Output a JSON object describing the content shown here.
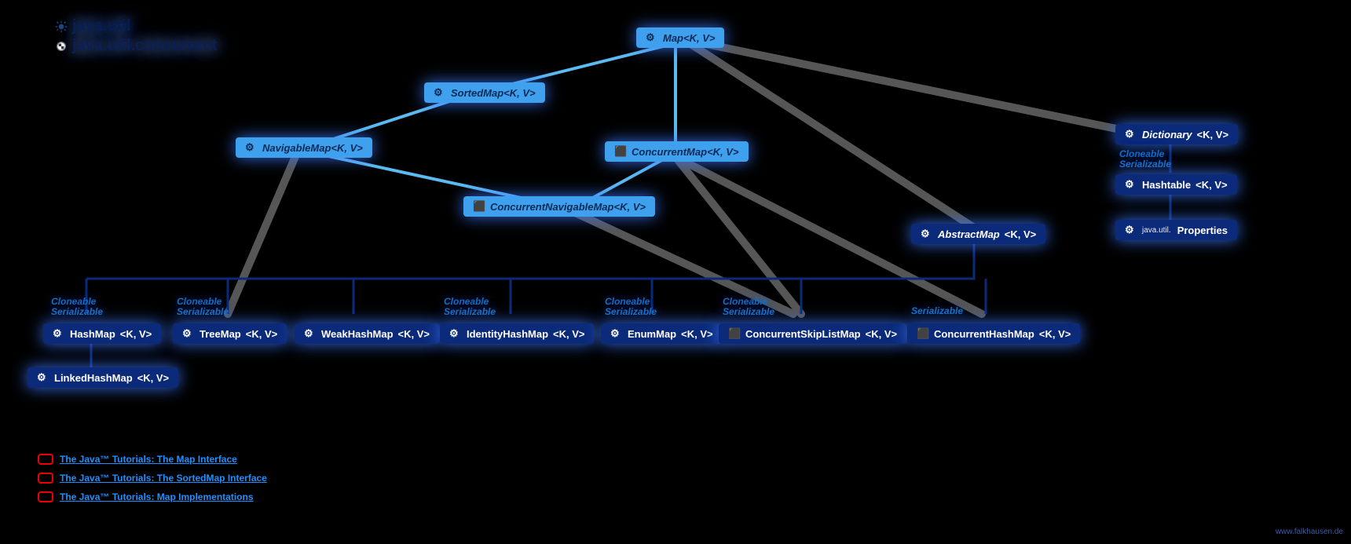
{
  "legend": {
    "pkg1": "java.util",
    "pkg2": "java.util.concurrent"
  },
  "nodes": {
    "map": {
      "label": "Map",
      "gen": "<K, V>"
    },
    "sortedmap": {
      "label": "SortedMap",
      "gen": "<K, V>"
    },
    "navmap": {
      "label": "NavigableMap",
      "gen": "<K, V>"
    },
    "concmap": {
      "label": "ConcurrentMap",
      "gen": "<K, V>"
    },
    "concnavmap": {
      "label": "ConcurrentNavigableMap",
      "gen": "<K, V>"
    },
    "absmap": {
      "label": "AbstractMap",
      "gen": "<K, V>"
    },
    "dict": {
      "label": "Dictionary",
      "gen": "<K, V>"
    },
    "hashtable": {
      "label": "Hashtable",
      "gen": "<K, V>"
    },
    "propspkg": "java.util.",
    "props": "Properties",
    "hashmap": {
      "label": "HashMap",
      "gen": "<K, V>"
    },
    "linkedhm": {
      "label": "LinkedHashMap",
      "gen": "<K, V>"
    },
    "treemap": {
      "label": "TreeMap",
      "gen": "<K, V>"
    },
    "weakhm": {
      "label": "WeakHashMap",
      "gen": "<K, V>"
    },
    "idhm": {
      "label": "IdentityHashMap",
      "gen": "<K, V>"
    },
    "enummap": {
      "label": "EnumMap",
      "gen": "<K, V>"
    },
    "cskiplm": {
      "label": "ConcurrentSkipListMap",
      "gen": "<K, V>"
    },
    "conchm": {
      "label": "ConcurrentHashMap",
      "gen": "<K, V>"
    }
  },
  "annot": {
    "clone": "Cloneable",
    "serial": "Serializable",
    "hashtable": "Cloneable\nSerializable",
    "hashmap": "Cloneable\nSerializable",
    "treemap": "Cloneable\nSerializable",
    "idhm": "Cloneable\nSerializable",
    "enummap": "Cloneable\nSerializable",
    "cskiplm": "Cloneable\nSerializable",
    "conchm": "Serializable"
  },
  "footerLinks": {
    "l1": "The Java™ Tutorials: The Map Interface",
    "l2": "The Java™ Tutorials: The SortedMap Interface",
    "l3": "The Java™ Tutorials: Map Implementations"
  },
  "source": "www.falkhausen.de"
}
